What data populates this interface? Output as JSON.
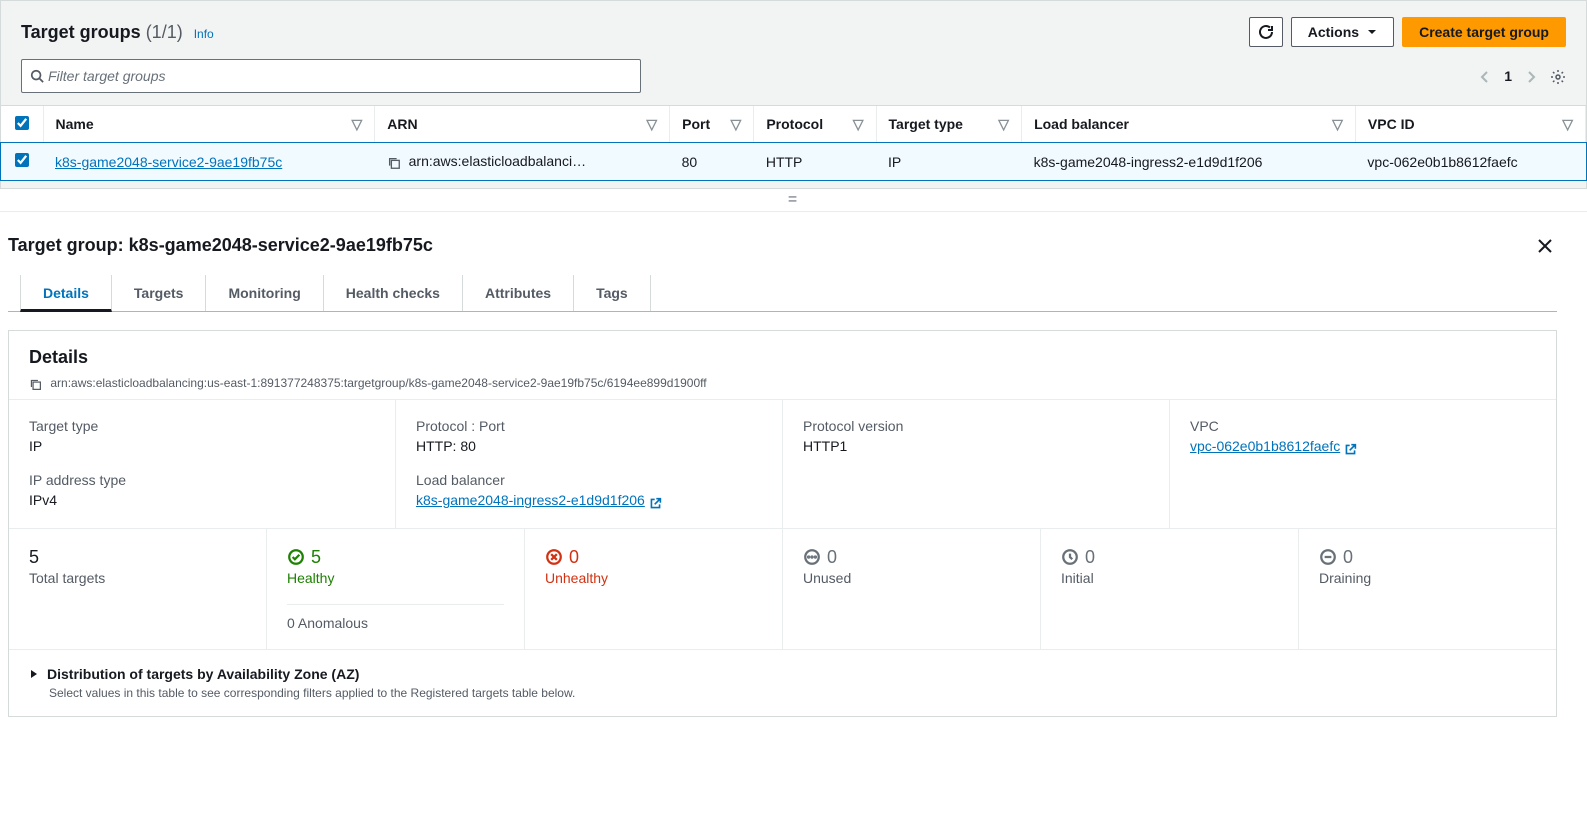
{
  "header": {
    "title": "Target groups",
    "count": "(1/1)",
    "info_label": "Info",
    "actions_label": "Actions",
    "create_label": "Create target group"
  },
  "search": {
    "placeholder": "Filter target groups"
  },
  "pagination": {
    "page": "1"
  },
  "table": {
    "headers": {
      "name": "Name",
      "arn": "ARN",
      "port": "Port",
      "protocol": "Protocol",
      "target_type": "Target type",
      "load_balancer": "Load balancer",
      "vpc_id": "VPC ID"
    },
    "row": {
      "name": "k8s-game2048-service2-9ae19fb75c",
      "arn": "arn:aws:elasticloadbalanci…",
      "port": "80",
      "protocol": "HTTP",
      "target_type": "IP",
      "load_balancer": "k8s-game2048-ingress2-e1d9d1f206",
      "vpc_id": "vpc-062e0b1b8612faefc"
    }
  },
  "detail": {
    "title": "Target group: k8s-game2048-service2-9ae19fb75c",
    "tabs": {
      "details": "Details",
      "targets": "Targets",
      "monitoring": "Monitoring",
      "health_checks": "Health checks",
      "attributes": "Attributes",
      "tags": "Tags"
    },
    "card_title": "Details",
    "arn": "arn:aws:elasticloadbalancing:us-east-1:891377248375:targetgroup/k8s-game2048-service2-9ae19fb75c/6194ee899d1900ff",
    "target_type": {
      "label": "Target type",
      "value": "IP"
    },
    "ip_addr_type": {
      "label": "IP address type",
      "value": "IPv4"
    },
    "protocol_port": {
      "label": "Protocol : Port",
      "value": "HTTP: 80"
    },
    "load_balancer": {
      "label": "Load balancer",
      "value": "k8s-game2048-ingress2-e1d9d1f206"
    },
    "protocol_version": {
      "label": "Protocol version",
      "value": "HTTP1"
    },
    "vpc": {
      "label": "VPC",
      "value": "vpc-062e0b1b8612faefc"
    },
    "stats": {
      "total": {
        "value": "5",
        "label": "Total targets"
      },
      "healthy": {
        "value": "5",
        "label": "Healthy",
        "anomalous": "0 Anomalous"
      },
      "unhealthy": {
        "value": "0",
        "label": "Unhealthy"
      },
      "unused": {
        "value": "0",
        "label": "Unused"
      },
      "initial": {
        "value": "0",
        "label": "Initial"
      },
      "draining": {
        "value": "0",
        "label": "Draining"
      }
    },
    "dist": {
      "title": "Distribution of targets by Availability Zone (AZ)",
      "desc": "Select values in this table to see corresponding filters applied to the Registered targets table below."
    }
  }
}
